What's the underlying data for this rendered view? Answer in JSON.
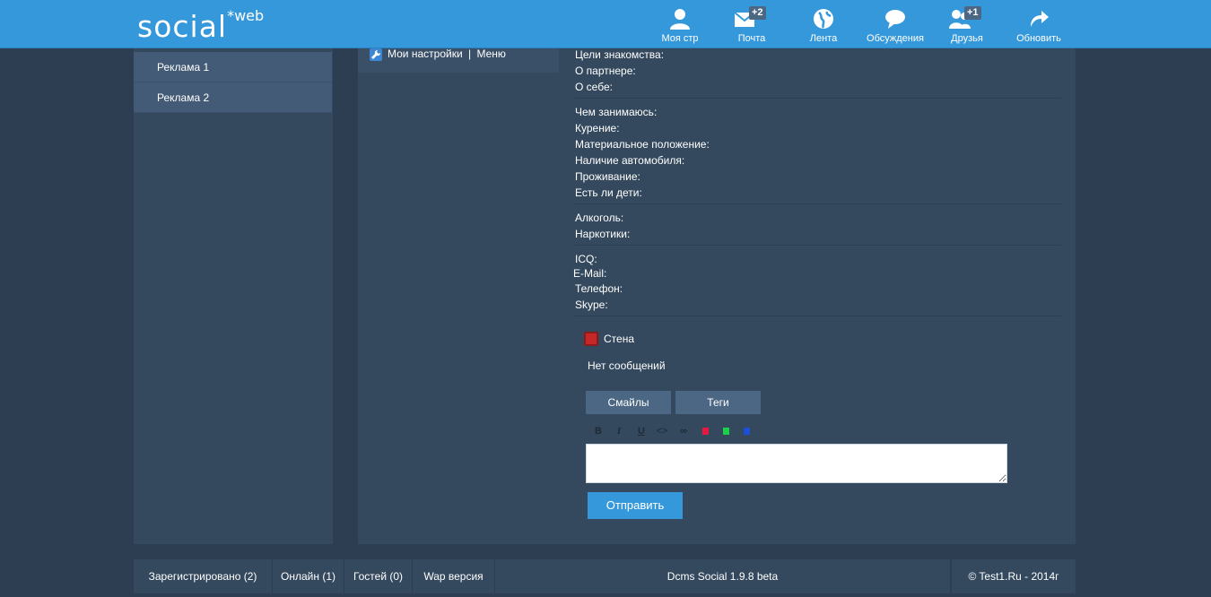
{
  "header": {
    "logo_main": "social",
    "logo_sup": "*web",
    "nav": [
      {
        "label": "Моя стр",
        "icon": "user-icon",
        "badge": ""
      },
      {
        "label": "Почта",
        "icon": "mail-icon",
        "badge": "+2"
      },
      {
        "label": "Лента",
        "icon": "globe-icon",
        "badge": ""
      },
      {
        "label": "Обсуждения",
        "icon": "chat-icon",
        "badge": ""
      },
      {
        "label": "Друзья",
        "icon": "friends-icon",
        "badge": "+1"
      },
      {
        "label": "Обновить",
        "icon": "refresh-icon",
        "badge": ""
      }
    ]
  },
  "sidebar": {
    "items": [
      {
        "label": "Реклама 1"
      },
      {
        "label": "Реклама 2"
      }
    ]
  },
  "settings": {
    "my_settings": "Мои настройки",
    "separator": "|",
    "menu": "Меню"
  },
  "profile": {
    "group1": [
      "Цели знакомства:",
      "О партнере:",
      "О себе:"
    ],
    "group2": [
      "Чем занимаюсь:",
      "Курение:",
      "Материальное положение:",
      "Наличие автомобиля:",
      "Проживание:",
      "Есть ли дети:"
    ],
    "group3": [
      "Алкоголь:",
      "Наркотики:"
    ],
    "group4": [
      "ICQ:",
      "E-Mail:",
      "Телефон:",
      "Skype:"
    ]
  },
  "wall": {
    "title": "Стена",
    "empty": "Нет сообщений",
    "tab_smiles": "Смайлы",
    "tab_tags": "Теги",
    "fmt_bold": "B",
    "fmt_italic": "I",
    "fmt_underline": "U",
    "fmt_code": "<>",
    "fmt_link": "∞",
    "colors": [
      "#e8193c",
      "#1bd14a",
      "#1a4fd6"
    ],
    "textarea_value": "",
    "send": "Отправить"
  },
  "footer": {
    "registered": "Зарегистрировано (2)",
    "online": "Онлайн (1)",
    "guests": "Гостей (0)",
    "wap": "Wap версия",
    "version": "Dcms Social 1.9.8 beta",
    "copyright": "© Test1.Ru - 2014г"
  }
}
